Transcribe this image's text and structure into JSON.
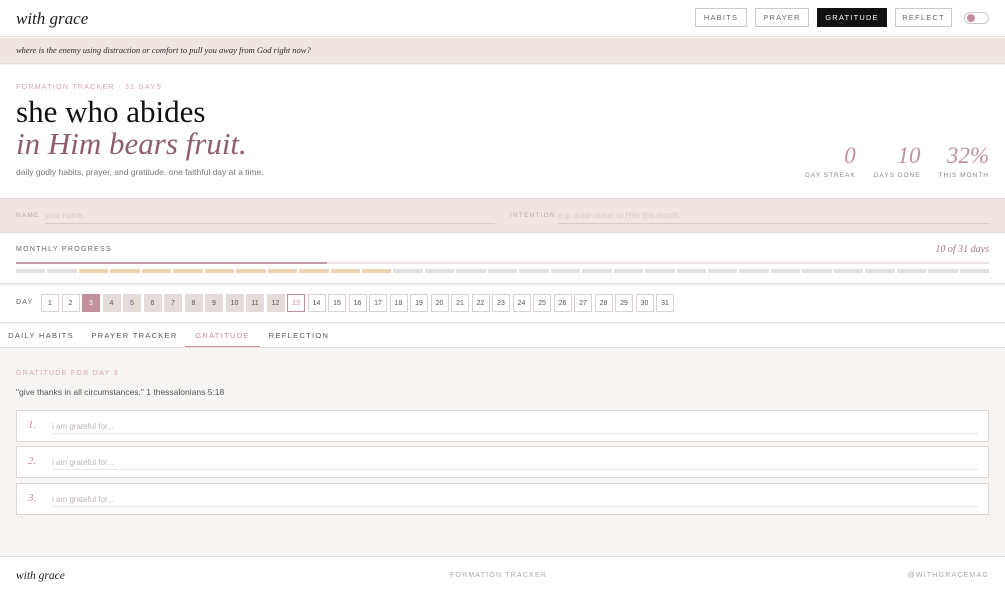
{
  "header": {
    "brand": "with grace",
    "nav": [
      "HABITS",
      "PRAYER",
      "GRATITUDE",
      "REFLECT"
    ],
    "active_nav": "GRATITUDE",
    "accent": "#c3909e"
  },
  "prompt": "where is the enemy using distraction or comfort to pull you away from God right now?",
  "hero": {
    "eyebrow": "FORMATION TRACKER · 31 DAYS",
    "headline": "she who abides",
    "headline_italic": "in Him bears fruit.",
    "subline": "daily godly habits, prayer, and gratitude. one faithful day at a time."
  },
  "stats": [
    {
      "value": "0",
      "label": "DAY STREAK"
    },
    {
      "value": "10",
      "label": "DAYS DONE"
    },
    {
      "value": "32%",
      "label": "THIS MONTH"
    }
  ],
  "fields": {
    "name_label": "NAME",
    "name_placeholder": "your name",
    "intention_label": "INTENTION",
    "intention_placeholder": "e.g. draw closer to Him this month"
  },
  "progress": {
    "label": "MONTHLY PROGRESS",
    "count": "10 of 31 days",
    "fraction": 0.32,
    "done_days": [
      3,
      4,
      5,
      6,
      7,
      8,
      9,
      10,
      11,
      12
    ]
  },
  "days": {
    "label": "DAY",
    "list": [
      "1",
      "2",
      "3",
      "4",
      "5",
      "6",
      "7",
      "8",
      "9",
      "10",
      "11",
      "12",
      "13",
      "14",
      "15",
      "16",
      "17",
      "18",
      "19",
      "20",
      "21",
      "22",
      "23",
      "24",
      "25",
      "26",
      "27",
      "28",
      "29",
      "30",
      "31"
    ],
    "selected": 3,
    "today": 13,
    "done": [
      4,
      5,
      6,
      7,
      8,
      9,
      10,
      11,
      12
    ]
  },
  "tabs": [
    "DAILY HABITS",
    "PRAYER TRACKER",
    "GRATITUDE",
    "REFLECTION"
  ],
  "active_tab": "GRATITUDE",
  "gratitude": {
    "label": "GRATITUDE FOR DAY 3",
    "verse": "\"give thanks in all circumstances.\" 1 thessalonians 5:18",
    "entries": [
      {
        "num": "1.",
        "placeholder": "i am grateful for..."
      },
      {
        "num": "2.",
        "placeholder": "i am grateful for..."
      },
      {
        "num": "3.",
        "placeholder": "i am grateful for..."
      }
    ]
  },
  "footer": {
    "brand": "with grace",
    "center": "FORMATION TRACKER",
    "handle": "@WITHGRACEMAG"
  }
}
